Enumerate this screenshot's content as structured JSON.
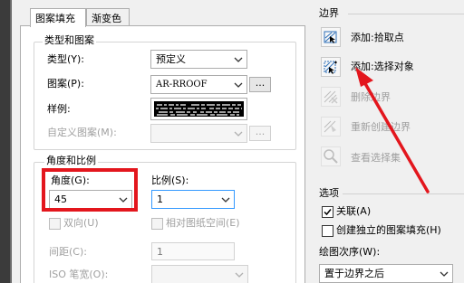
{
  "tabs": [
    {
      "label": "图案填充",
      "active": true
    },
    {
      "label": "渐变色",
      "active": false
    }
  ],
  "type_pattern": {
    "title": "类型和图案",
    "type_label": "类型(Y):",
    "type_value": "预定义",
    "pattern_label": "图案(P):",
    "pattern_value": "AR-RROOF",
    "pattern_browse": "...",
    "swatch_label": "样例:",
    "custom_label": "自定义图案(M):",
    "custom_browse": "..."
  },
  "angle_scale": {
    "title": "角度和比例",
    "angle_label": "角度(G):",
    "angle_value": "45",
    "scale_label": "比例(S):",
    "scale_value": "1",
    "double_label": "双向(U)",
    "relative_label": "相对图纸空间(E)",
    "spacing_label": "间距(C):",
    "spacing_value": "1",
    "iso_label": "ISO 笔宽(O):"
  },
  "boundaries": {
    "title": "边界",
    "add_pick": "添加:拾取点",
    "add_select": "添加:选择对象",
    "remove": "删除边界",
    "recreate": "重新创建边界",
    "view": "查看选择集"
  },
  "options": {
    "title": "选项",
    "associative_label": "关联(A)",
    "associative_checked": true,
    "separate_label": "创建独立的图案填充(H)",
    "separate_checked": false,
    "draw_order_label": "绘图次序(W):",
    "draw_order_value": "置于边界之后"
  },
  "icons": [
    "pick-point-icon",
    "select-objects-icon",
    "remove-boundary-icon",
    "recreate-boundary-icon",
    "view-selection-icon",
    "chevron-down-icon"
  ],
  "colors": {
    "highlight": "#e3161d",
    "focus_border": "#3399ff"
  }
}
